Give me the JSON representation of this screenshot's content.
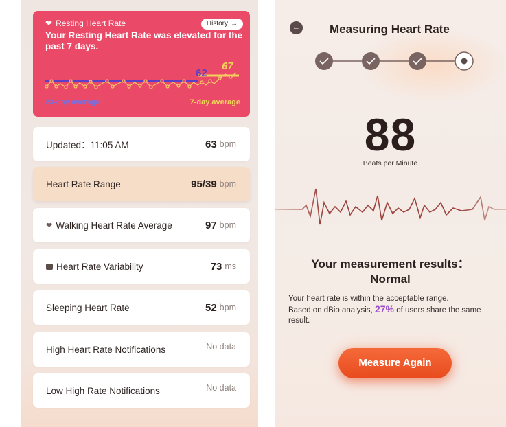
{
  "left": {
    "rhr": {
      "title": "Resting Heart Rate",
      "history_label": "History",
      "message": "Your Resting Heart Rate was elevated for the past 7 days.",
      "avg23_value": "62",
      "avg7_value": "67",
      "avg23_label": "23-day average",
      "avg7_label": "7-day average"
    },
    "updated": {
      "label": "Updated：11:05 AM",
      "value": "63",
      "unit": "bpm"
    },
    "range": {
      "label": "Heart Rate Range",
      "value": "95/39",
      "unit": "bpm"
    },
    "walking": {
      "label": "Walking Heart Rate Average",
      "value": "97",
      "unit": "bpm"
    },
    "hrv": {
      "label": "Heart Rate Variability",
      "value": "73",
      "unit": "ms"
    },
    "sleeping": {
      "label": "Sleeping Heart Rate",
      "value": "52",
      "unit": "bpm"
    },
    "high_notif": {
      "label": "High Heart Rate Notifications",
      "value": "No data"
    },
    "low_notif": {
      "label": "Low High Rate Notifications",
      "value": "No data"
    }
  },
  "right": {
    "title": "Measuring Heart Rate",
    "bpm_value": "88",
    "bpm_label": "Beats per Minute",
    "result_title_line1": "Your measurement results：",
    "result_title_line2": "Normal",
    "desc_line1": "Your heart rate is within the acceptable range.",
    "desc_prefix": "Based on dBio analysis,",
    "desc_percent": "27%",
    "desc_suffix": "of users share the same result.",
    "button_label": "Measure Again"
  },
  "colors": {
    "rhr_card": "#ea4a67",
    "avg23": "#5c3fc6",
    "avg7": "#f1d35a",
    "accent_button": "#e84b1e",
    "percent": "#9b50c8"
  }
}
